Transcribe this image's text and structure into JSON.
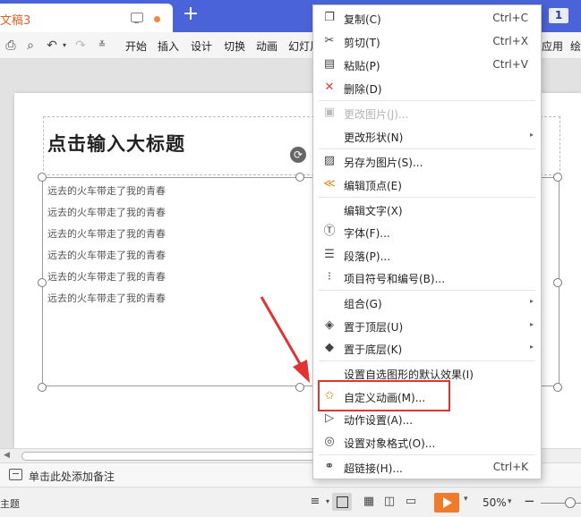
{
  "titlebar": {
    "doc_title": "文稿3",
    "page_number": "1",
    "add_tab_label": "+"
  },
  "ribbon": {
    "tabs": [
      "开始",
      "插入",
      "设计",
      "切换",
      "动画",
      "幻灯片"
    ],
    "tabs_right": [
      "应用",
      "绘"
    ]
  },
  "slide": {
    "title": "点击输入大标题",
    "body_lines": [
      "远去的火车带走了我的青春",
      "远去的火车带走了我的青春",
      "远去的火车带走了我的青春",
      "远去的火车带走了我的青春",
      "远去的火车带走了我的青春",
      "远去的火车带走了我的青春"
    ]
  },
  "notes": {
    "placeholder": "单击此处添加备注"
  },
  "statusbar": {
    "theme_label": "主题",
    "zoom": "50%"
  },
  "context_menu": {
    "items": [
      {
        "icon": "copy-icon",
        "label": "复制(C)",
        "shortcut": "Ctrl+C"
      },
      {
        "icon": "cut-icon",
        "label": "剪切(T)",
        "shortcut": "Ctrl+X"
      },
      {
        "icon": "paste-icon",
        "label": "粘贴(P)",
        "shortcut": "Ctrl+V"
      },
      {
        "icon": "delete-icon",
        "label": "删除(D)",
        "shortcut": ""
      },
      {
        "icon": "change-picture-icon",
        "label": "更改图片(J)...",
        "shortcut": "",
        "disabled": true
      },
      {
        "icon": "",
        "label": "更改形状(N)",
        "shortcut": "",
        "submenu": true
      },
      {
        "icon": "save-as-picture-icon",
        "label": "另存为图片(S)...",
        "shortcut": ""
      },
      {
        "icon": "edit-points-icon",
        "label": "编辑顶点(E)",
        "shortcut": ""
      },
      {
        "icon": "",
        "label": "编辑文字(X)",
        "shortcut": ""
      },
      {
        "icon": "font-icon",
        "label": "字体(F)...",
        "shortcut": ""
      },
      {
        "icon": "paragraph-icon",
        "label": "段落(P)...",
        "shortcut": ""
      },
      {
        "icon": "bullets-icon",
        "label": "项目符号和编号(B)...",
        "shortcut": ""
      },
      {
        "icon": "",
        "label": "组合(G)",
        "shortcut": "",
        "submenu": true
      },
      {
        "icon": "bring-to-front-icon",
        "label": "置于顶层(U)",
        "shortcut": "",
        "submenu": true
      },
      {
        "icon": "send-to-back-icon",
        "label": "置于底层(K)",
        "shortcut": "",
        "submenu": true
      },
      {
        "icon": "",
        "label": "设置自选图形的默认效果(I)",
        "shortcut": ""
      },
      {
        "icon": "custom-animation-icon",
        "label": "自定义动画(M)...",
        "shortcut": ""
      },
      {
        "icon": "action-settings-icon",
        "label": "动作设置(A)...",
        "shortcut": ""
      },
      {
        "icon": "format-object-icon",
        "label": "设置对象格式(O)...",
        "shortcut": ""
      },
      {
        "icon": "hyperlink-icon",
        "label": "超链接(H)...",
        "shortcut": "Ctrl+K"
      }
    ]
  },
  "colors": {
    "titlebar": "#4b63d9",
    "doc_title": "#e0602a",
    "annotation_red": "#e33232",
    "play_button": "#f07b2b"
  }
}
